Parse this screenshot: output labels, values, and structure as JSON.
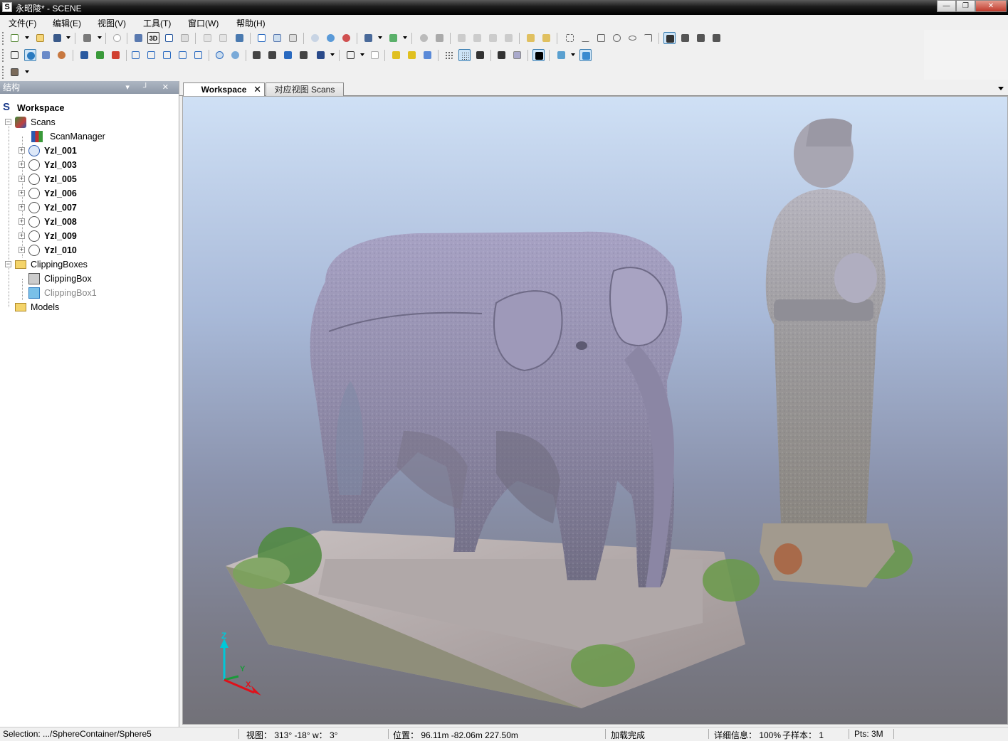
{
  "window": {
    "title": "永昭陵* - SCENE",
    "app_icon": "scene-s-icon",
    "buttons": [
      "minimize",
      "maximize",
      "close"
    ]
  },
  "menubar": {
    "items": [
      "文件(F)",
      "编辑(E)",
      "视图(V)",
      "工具(T)",
      "窗口(W)",
      "帮助(H)"
    ]
  },
  "toolbar": {
    "label_3d": "3D"
  },
  "structure_panel": {
    "title": "结构",
    "header_buttons": [
      "dropdown",
      "pin",
      "close"
    ],
    "tree": {
      "workspace": "Workspace",
      "scans": "Scans",
      "scan_manager": "ScanManager",
      "scan_items": [
        "Yzl_001",
        "Yzl_003",
        "Yzl_005",
        "Yzl_006",
        "Yzl_007",
        "Yzl_008",
        "Yzl_009",
        "Yzl_010"
      ],
      "clipping_boxes": "ClippingBoxes",
      "clipping_box": "ClippingBox",
      "clipping_box1": "ClippingBox1",
      "models": "Models"
    }
  },
  "tabs": [
    {
      "label": "Workspace",
      "active": true
    },
    {
      "label": "对应视图 Scans",
      "active": false
    }
  ],
  "viewport": {
    "axes": {
      "z": "Z",
      "y": "Y",
      "x": "X"
    },
    "colors": {
      "sky_top": "#cfe0f5",
      "floor": "#727178",
      "axis_z": "#00c8d8",
      "axis_y": "#1a9a3a",
      "axis_x": "#e0101a"
    }
  },
  "statusbar": {
    "selection": "Selection: .../SphereContainer/Sphere5",
    "view": "视图： 313° -18° w： 3°",
    "position": "位置： 96.11m -82.06m 227.50m",
    "load_status": "加载完成",
    "detail": "详细信息： 100%",
    "subsample": "子样本： 1",
    "points": "Pts: 3M"
  }
}
